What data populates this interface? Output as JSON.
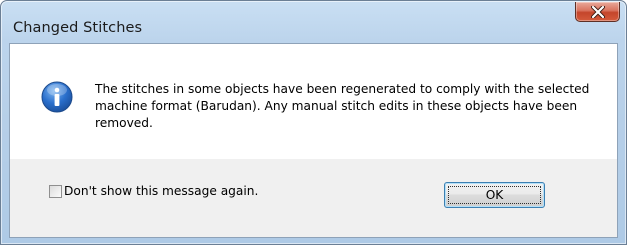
{
  "window": {
    "title": "Changed Stitches",
    "close_icon": "close-icon"
  },
  "message": {
    "icon": "info-icon",
    "text": "The stitches in some objects have been regenerated to comply with the selected machine format (Barudan). Any manual stitch edits in these objects have been removed."
  },
  "footer": {
    "checkbox_label": "Don't show this message again.",
    "checkbox_checked": false,
    "ok_label": "OK"
  },
  "colors": {
    "close_button": "#c4452b",
    "info_icon": "#1e5eb8",
    "ok_border": "#3c7fb1"
  }
}
